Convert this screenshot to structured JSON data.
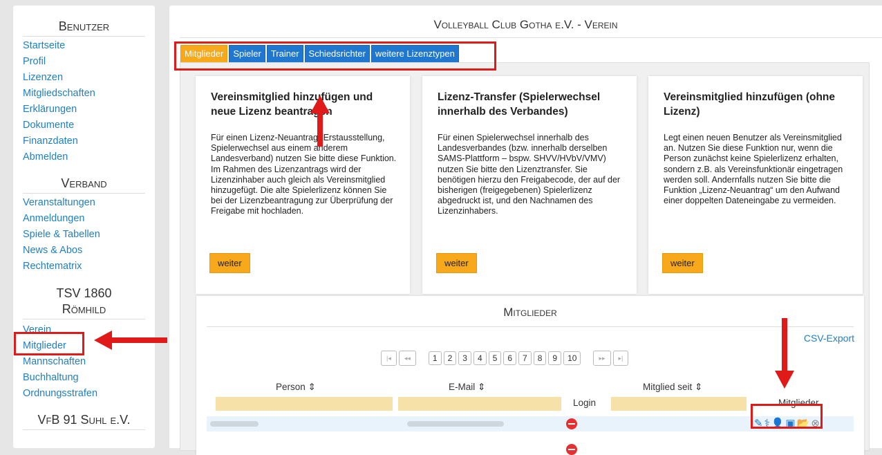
{
  "sidebar": {
    "benutzer_heading": "Benutzer",
    "benutzer_items": [
      "Startseite",
      "Profil",
      "Lizenzen",
      "Mitgliedschaften",
      "Erklärungen",
      "Dokumente",
      "Finanzdaten",
      "Abmelden"
    ],
    "verband_heading": "Verband",
    "verband_items": [
      "Veranstaltungen",
      "Anmeldungen",
      "Spiele & Tabellen",
      "News & Abos",
      "Rechtematrix"
    ],
    "club_heading_line1": "TSV 1860",
    "club_heading_line2": "Römhild",
    "club_items": [
      "Verein",
      "Mitglieder",
      "Mannschaften",
      "Buchhaltung",
      "Ordnungsstrafen"
    ],
    "club2_heading": "VfB 91 Suhl e.V."
  },
  "main": {
    "title": "Volleyball Club Gotha e.V. - Verein",
    "tabs": [
      "Mitglieder",
      "Spieler",
      "Trainer",
      "Schiedsrichter",
      "weitere Lizenztypen"
    ],
    "cards": [
      {
        "title": "Vereinsmitglied hinzufügen und neue Lizenz beantragen",
        "text": "Für einen Lizenz-Neuantrag (Erstausstellung, Spielerwechsel aus einem anderem Landesverband) nutzen Sie bitte diese Funktion. Im Rahmen des Lizenzantrags wird der Lizenzinhaber auch gleich als Vereinsmitglied hinzugefügt. Die alte Spielerlizenz können Sie bei der Lizenzbeantragung zur Überprüfung der Freigabe mit hochladen.",
        "button": "weiter"
      },
      {
        "title": "Lizenz-Transfer (Spielerwechsel innerhalb des Verbandes)",
        "text": "Für einen Spielerwechsel innerhalb des Landesverbandes (bzw. innerhalb derselben SAMS-Plattform – bspw. SHVV/HVbV/VMV) nutzen Sie bitte den Lizenztransfer. Sie benötigen hierzu den Freigabecode, der auf der bisherigen (freigegebenen) Spielerlizenz abgedruckt ist, und den Nachnamen des Lizenzinhabers.",
        "button": "weiter"
      },
      {
        "title": "Vereinsmitglied hinzufügen (ohne Lizenz)",
        "text": "Legt einen neuen Benutzer als Vereinsmitglied an. Nutzen Sie diese Funktion nur, wenn die Person zunächst keine Spielerlizenz erhalten, sondern z.B. als Vereinsfunktionär eingetragen werden soll. Andernfalls nutzen Sie bitte die Funktion „Lizenz-Neuantrag“ um den Aufwand einer doppelten Dateneingabe zu vermeiden.",
        "button": "weiter"
      }
    ],
    "members": {
      "title": "Mitglieder",
      "csv_export": "CSV-Export",
      "pager_pages": [
        "1",
        "2",
        "3",
        "4",
        "5",
        "6",
        "7",
        "8",
        "9",
        "10"
      ],
      "pager_first": "|◂",
      "pager_prev": "◂◂",
      "pager_next": "▸▸",
      "pager_last": "▸|",
      "col_person": "Person ⇕",
      "col_email": "E-Mail ⇕",
      "col_login": "Login",
      "col_since": "Mitglied seit ⇕",
      "col_members": "Mitglieder"
    }
  },
  "colors": {
    "accent_orange": "#f7a81b",
    "tab_blue": "#1f77cf",
    "link_blue": "#1f7fc0",
    "annotation_red": "#e01919"
  }
}
